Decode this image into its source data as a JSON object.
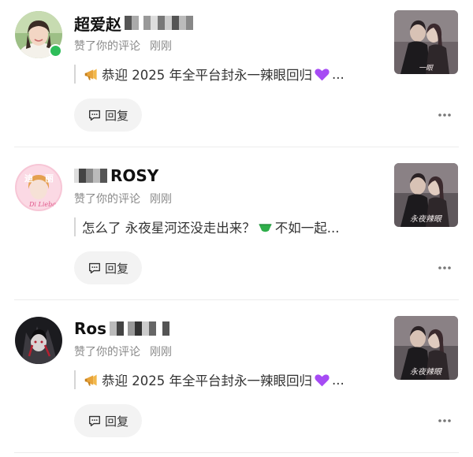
{
  "notifications": [
    {
      "username": "超爱赵",
      "username_suffix": "",
      "action": "赞了你的评论",
      "time": "刚刚",
      "comment": "恭迎 2025 年全平台封永一辣眼回归",
      "comment_end": "...",
      "prefix_emoji": "megaphone-emoji",
      "suffix_emoji": "purple-heart-emoji",
      "reply_label": "回复",
      "online": true
    },
    {
      "username": "",
      "username_suffix": "ROSY",
      "action": "赞了你的评论",
      "time": "刚刚",
      "comment": "怎么了 永夜星河还没走出来？",
      "comment_end": "不如一起...",
      "prefix_emoji": "",
      "suffix_emoji": "green-emoji",
      "reply_label": "回复",
      "online": false
    },
    {
      "username": "Ros",
      "username_suffix": "",
      "action": "赞了你的评论",
      "time": "刚刚",
      "comment": "恭迎 2025 年全平台封永一辣眼回归",
      "comment_end": "...",
      "prefix_emoji": "megaphone-emoji",
      "suffix_emoji": "purple-heart-emoji",
      "reply_label": "回复",
      "online": false
    }
  ],
  "colors": {
    "secondary_text": "#8a8a8a",
    "online_green": "#2ebd59",
    "button_bg": "#f3f3f3",
    "heart_purple": "#a64bf4"
  }
}
